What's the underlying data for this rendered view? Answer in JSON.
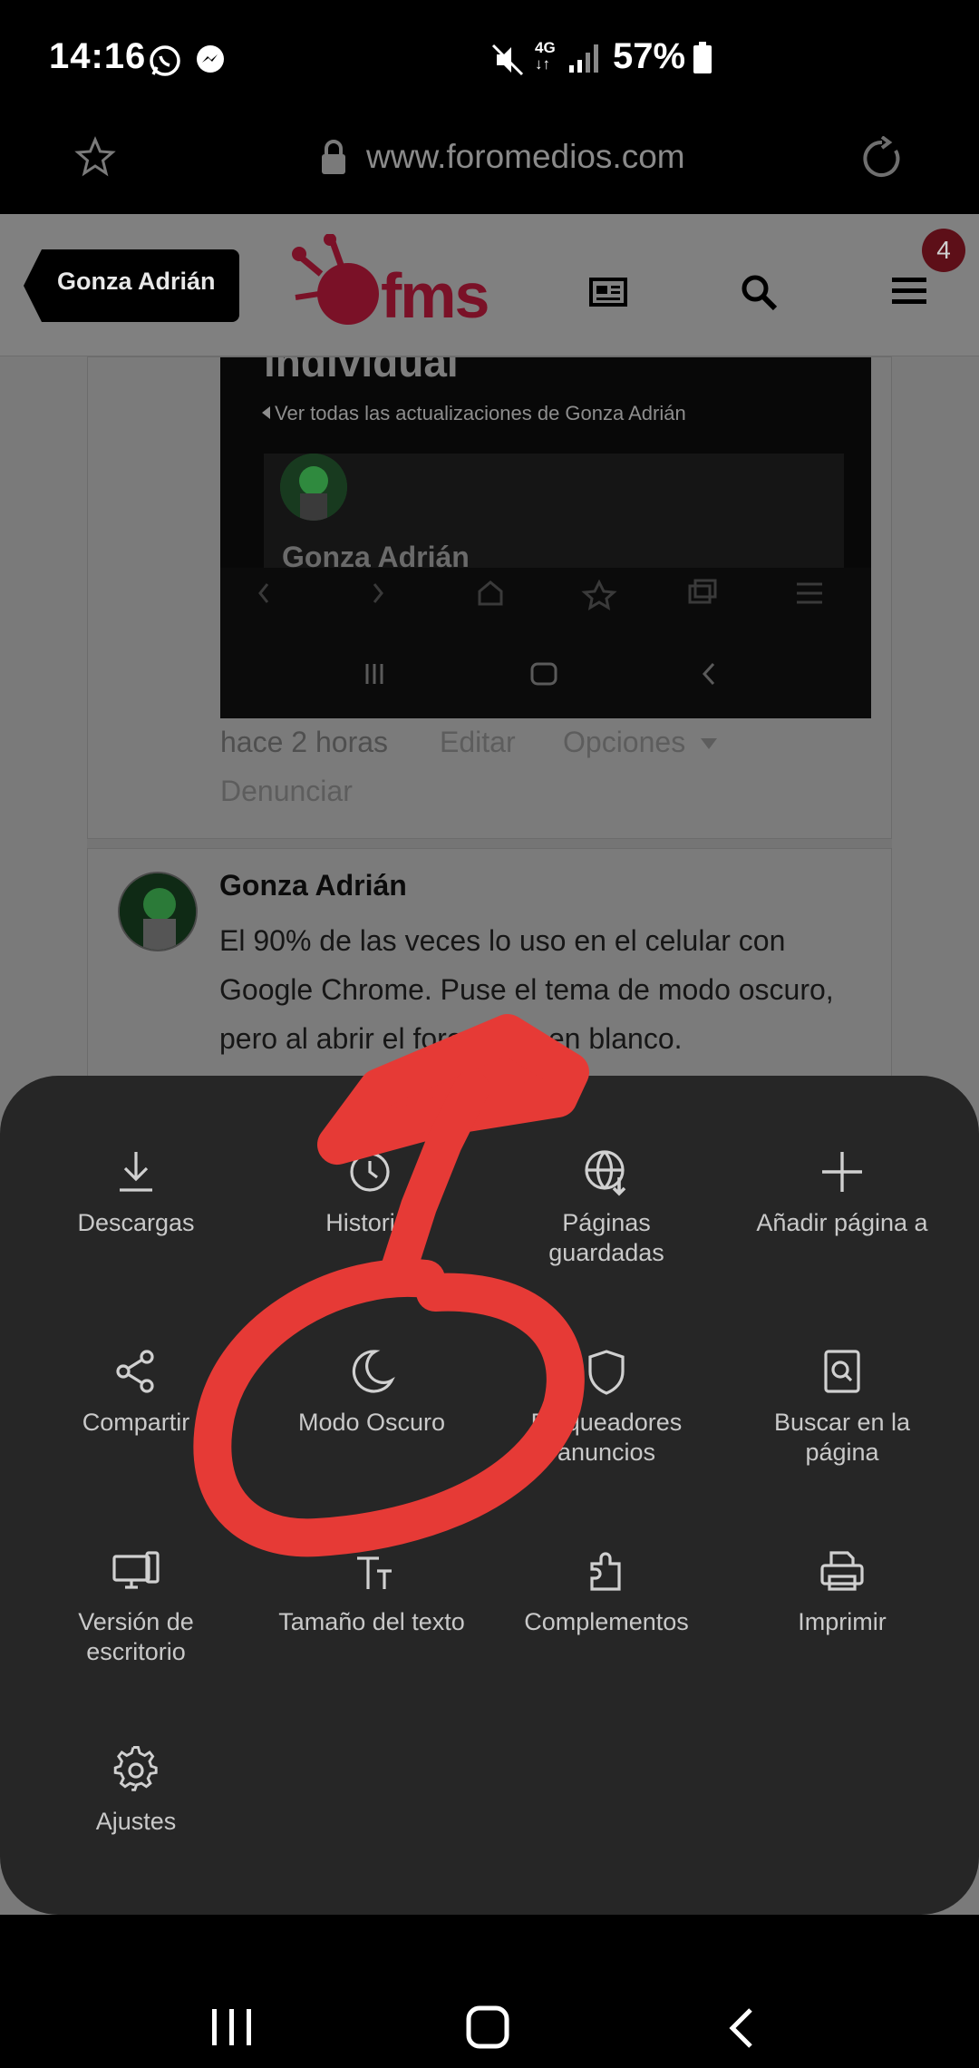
{
  "status": {
    "time": "14:16",
    "battery": "57%",
    "network": "4G"
  },
  "browser": {
    "url": "www.foromedios.com"
  },
  "site": {
    "user_tag": "Gonza Adrián",
    "logo_text": "fms",
    "notification_count": "4"
  },
  "embed": {
    "title_fragment": "individual",
    "link": "Ver todas las actualizaciones de Gonza Adrián",
    "name": "Gonza Adrián"
  },
  "post1_meta": {
    "time": "hace 2 horas",
    "edit": "Editar",
    "options": "Opciones",
    "report": "Denunciar"
  },
  "post2": {
    "author": "Gonza Adrián",
    "line1": "El 90% de las veces lo uso en el celular con",
    "line2": "Google Chrome. Puse el tema de modo oscuro,",
    "line3": "pero al abrir el foro se ve en blanco."
  },
  "menu": {
    "items": [
      {
        "label": "Descargas",
        "icon": "download-icon"
      },
      {
        "label": "Historial",
        "icon": "history-icon"
      },
      {
        "label": "Páginas\nguardadas",
        "icon": "saved-pages-icon"
      },
      {
        "label": "Añadir página a",
        "icon": "add-icon"
      },
      {
        "label": "Compartir",
        "icon": "share-icon"
      },
      {
        "label": "Modo Oscuro",
        "icon": "moon-icon"
      },
      {
        "label": "Bloqueadores\nanuncios",
        "icon": "shield-icon"
      },
      {
        "label": "Buscar en la\npágina",
        "icon": "find-in-page-icon"
      },
      {
        "label": "Versión de\nescritorio",
        "icon": "desktop-icon"
      },
      {
        "label": "Tamaño del texto",
        "icon": "text-size-icon"
      },
      {
        "label": "Complementos",
        "icon": "addons-icon"
      },
      {
        "label": "Imprimir",
        "icon": "print-icon"
      },
      {
        "label": "Ajustes",
        "icon": "gear-icon"
      }
    ]
  },
  "colors": {
    "sheet_bg": "#262626",
    "annotation": "#e63a36",
    "brand": "#7a1127"
  }
}
